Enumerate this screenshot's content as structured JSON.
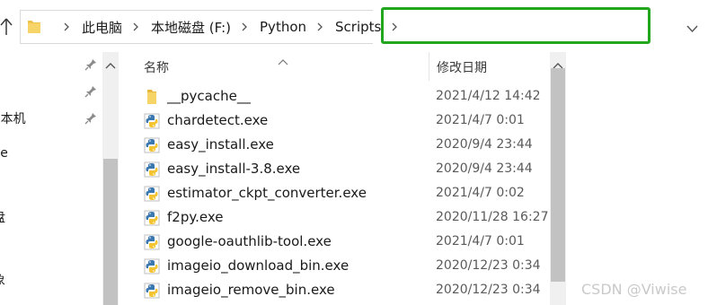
{
  "breadcrumb": {
    "items": [
      "此电脑",
      "本地磁盘 (F:)",
      "Python",
      "Scripts"
    ]
  },
  "search": {
    "value": ""
  },
  "nav": {
    "items": [
      "e本机",
      "ve",
      "盘",
      "象"
    ]
  },
  "columns": {
    "name": "名称",
    "date_modified": "修改日期"
  },
  "files": [
    {
      "name": "__pycache__",
      "date": "2021/4/12 14:42",
      "icon": "folder-icon"
    },
    {
      "name": "chardetect.exe",
      "date": "2021/4/7 0:01",
      "icon": "python-exe-icon"
    },
    {
      "name": "easy_install.exe",
      "date": "2020/9/4 23:44",
      "icon": "python-exe-icon"
    },
    {
      "name": "easy_install-3.8.exe",
      "date": "2020/9/4 23:44",
      "icon": "python-exe-icon"
    },
    {
      "name": "estimator_ckpt_converter.exe",
      "date": "2021/4/7 0:02",
      "icon": "python-exe-icon"
    },
    {
      "name": "f2py.exe",
      "date": "2020/11/28 16:27",
      "icon": "python-exe-icon"
    },
    {
      "name": "google-oauthlib-tool.exe",
      "date": "2021/4/7 0:01",
      "icon": "python-exe-icon"
    },
    {
      "name": "imageio_download_bin.exe",
      "date": "2020/12/23 0:34",
      "icon": "python-exe-icon"
    },
    {
      "name": "imageio_remove_bin.exe",
      "date": "2020/12/23 0:34",
      "icon": "python-exe-icon"
    }
  ],
  "watermark": "CSDN @Viwise",
  "colors": {
    "search_highlight": "#22a61e",
    "folder": "#f0c24b",
    "python_blue": "#3b78b0",
    "python_yellow": "#f5c531"
  }
}
